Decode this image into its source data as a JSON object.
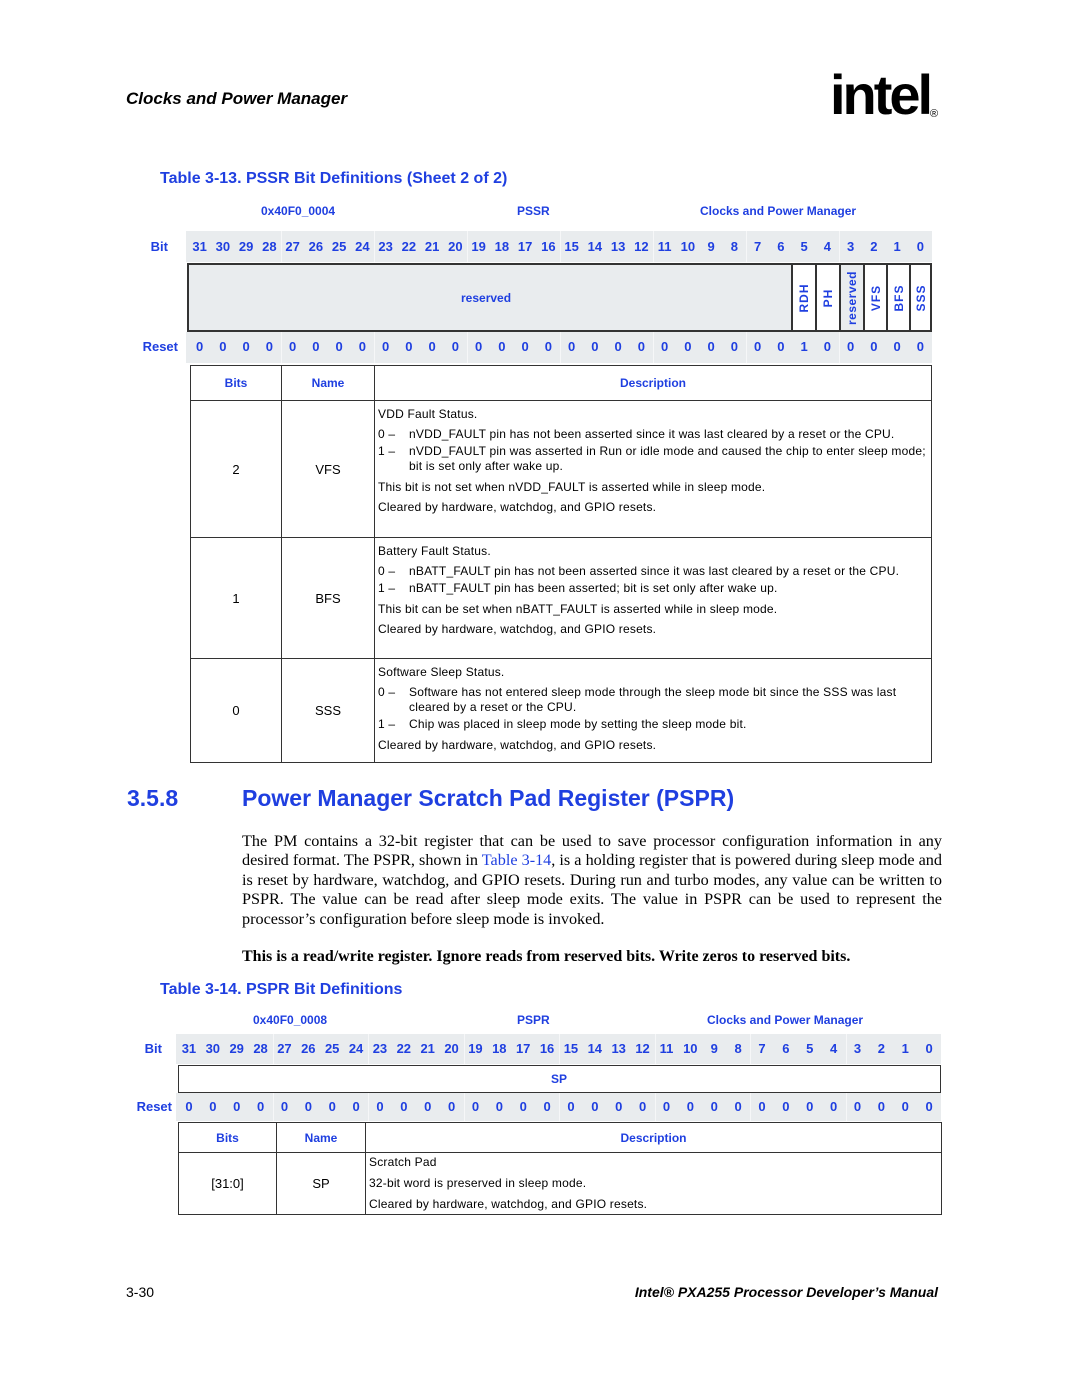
{
  "page": {
    "running_head": "Clocks and Power Manager",
    "logo_text": "intel",
    "logo_reg": "®",
    "footer_page": "3-30",
    "footer_title": "Intel® PXA255 Processor Developer’s Manual"
  },
  "table13": {
    "caption": "Table 3-13. PSSR Bit Definitions (Sheet 2 of 2)",
    "address": "0x40F0_0004",
    "register": "PSSR",
    "unit": "Clocks and Power Manager",
    "bit_label": "Bit",
    "reset_label": "Reset",
    "bits": [
      "31",
      "30",
      "29",
      "28",
      "27",
      "26",
      "25",
      "24",
      "23",
      "22",
      "21",
      "20",
      "19",
      "18",
      "17",
      "16",
      "15",
      "14",
      "13",
      "12",
      "11",
      "10",
      "9",
      "8",
      "7",
      "6",
      "5",
      "4",
      "3",
      "2",
      "1",
      "0"
    ],
    "reset": [
      "0",
      "0",
      "0",
      "0",
      "0",
      "0",
      "0",
      "0",
      "0",
      "0",
      "0",
      "0",
      "0",
      "0",
      "0",
      "0",
      "0",
      "0",
      "0",
      "0",
      "0",
      "0",
      "0",
      "0",
      "0",
      "0",
      "1",
      "0",
      "0",
      "0",
      "0",
      "0"
    ],
    "fields": {
      "reserved_wide": "reserved",
      "rdh": "RDH",
      "ph": "PH",
      "reserved_bit3": "reserved",
      "vfs": "VFS",
      "bfs": "BFS",
      "sss": "SSS"
    },
    "headers": {
      "bits": "Bits",
      "name": "Name",
      "description": "Description"
    },
    "rows": [
      {
        "bits": "2",
        "name": "VFS",
        "title": "VDD Fault Status.",
        "items": [
          {
            "k": "0 –",
            "v": "nVDD_FAULT pin has not been asserted since it was last cleared by a reset or the CPU."
          },
          {
            "k": "1 –",
            "v": "nVDD_FAULT pin was asserted in Run or idle mode and caused the chip to enter sleep mode; bit is set only after wake up."
          }
        ],
        "notes": [
          "This bit is not set when nVDD_FAULT is asserted while in sleep mode.",
          "Cleared by hardware, watchdog, and GPIO resets."
        ]
      },
      {
        "bits": "1",
        "name": "BFS",
        "title": "Battery Fault Status.",
        "items": [
          {
            "k": "0 –",
            "v": "nBATT_FAULT pin has not been asserted since it was last cleared by a reset or the CPU."
          },
          {
            "k": "1 –",
            "v": "nBATT_FAULT pin has been asserted; bit is set only after wake up."
          }
        ],
        "notes": [
          "This bit can be set when nBATT_FAULT is asserted while in sleep mode.",
          "Cleared by hardware, watchdog, and GPIO resets."
        ]
      },
      {
        "bits": "0",
        "name": "SSS",
        "title": "Software Sleep Status.",
        "items": [
          {
            "k": "0 –",
            "v": "Software has not entered sleep mode through the sleep mode bit since the SSS was last cleared by a reset or the CPU."
          },
          {
            "k": "1 –",
            "v": "Chip was placed in sleep mode by setting the sleep mode bit."
          }
        ],
        "notes": [
          "Cleared by hardware, watchdog, and GPIO resets."
        ]
      }
    ]
  },
  "section": {
    "number": "3.5.8",
    "title": "Power Manager Scratch Pad Register (PSPR)",
    "para_before_link": "The PM contains a 32-bit register that can be used to save processor configuration information in any desired format. The PSPR, shown in ",
    "para_link": "Table 3-14",
    "para_after_link": ", is a holding register that is powered during sleep mode and is reset by hardware, watchdog, and GPIO resets. During run and turbo modes, any value can be written to PSPR. The value can be read after sleep mode exits. The value in PSPR can be used to represent the processor’s configuration before sleep mode is invoked.",
    "note": "This is a read/write register. Ignore reads from reserved bits. Write zeros to reserved bits."
  },
  "table14": {
    "caption": "Table 3-14. PSPR Bit Definitions",
    "address": "0x40F0_0008",
    "register": "PSPR",
    "unit": "Clocks and Power Manager",
    "bit_label": "Bit",
    "reset_label": "Reset",
    "bits": [
      "31",
      "30",
      "29",
      "28",
      "27",
      "26",
      "25",
      "24",
      "23",
      "22",
      "21",
      "20",
      "19",
      "18",
      "17",
      "16",
      "15",
      "14",
      "13",
      "12",
      "11",
      "10",
      "9",
      "8",
      "7",
      "6",
      "5",
      "4",
      "3",
      "2",
      "1",
      "0"
    ],
    "reset": [
      "0",
      "0",
      "0",
      "0",
      "0",
      "0",
      "0",
      "0",
      "0",
      "0",
      "0",
      "0",
      "0",
      "0",
      "0",
      "0",
      "0",
      "0",
      "0",
      "0",
      "0",
      "0",
      "0",
      "0",
      "0",
      "0",
      "0",
      "0",
      "0",
      "0",
      "0",
      "0"
    ],
    "field": "SP",
    "headers": {
      "bits": "Bits",
      "name": "Name",
      "description": "Description"
    },
    "rows": [
      {
        "bits": "[31:0]",
        "name": "SP",
        "lines": [
          "Scratch Pad",
          "32-bit word is preserved in sleep mode.",
          "Cleared by hardware, watchdog, and GPIO resets."
        ]
      }
    ]
  }
}
